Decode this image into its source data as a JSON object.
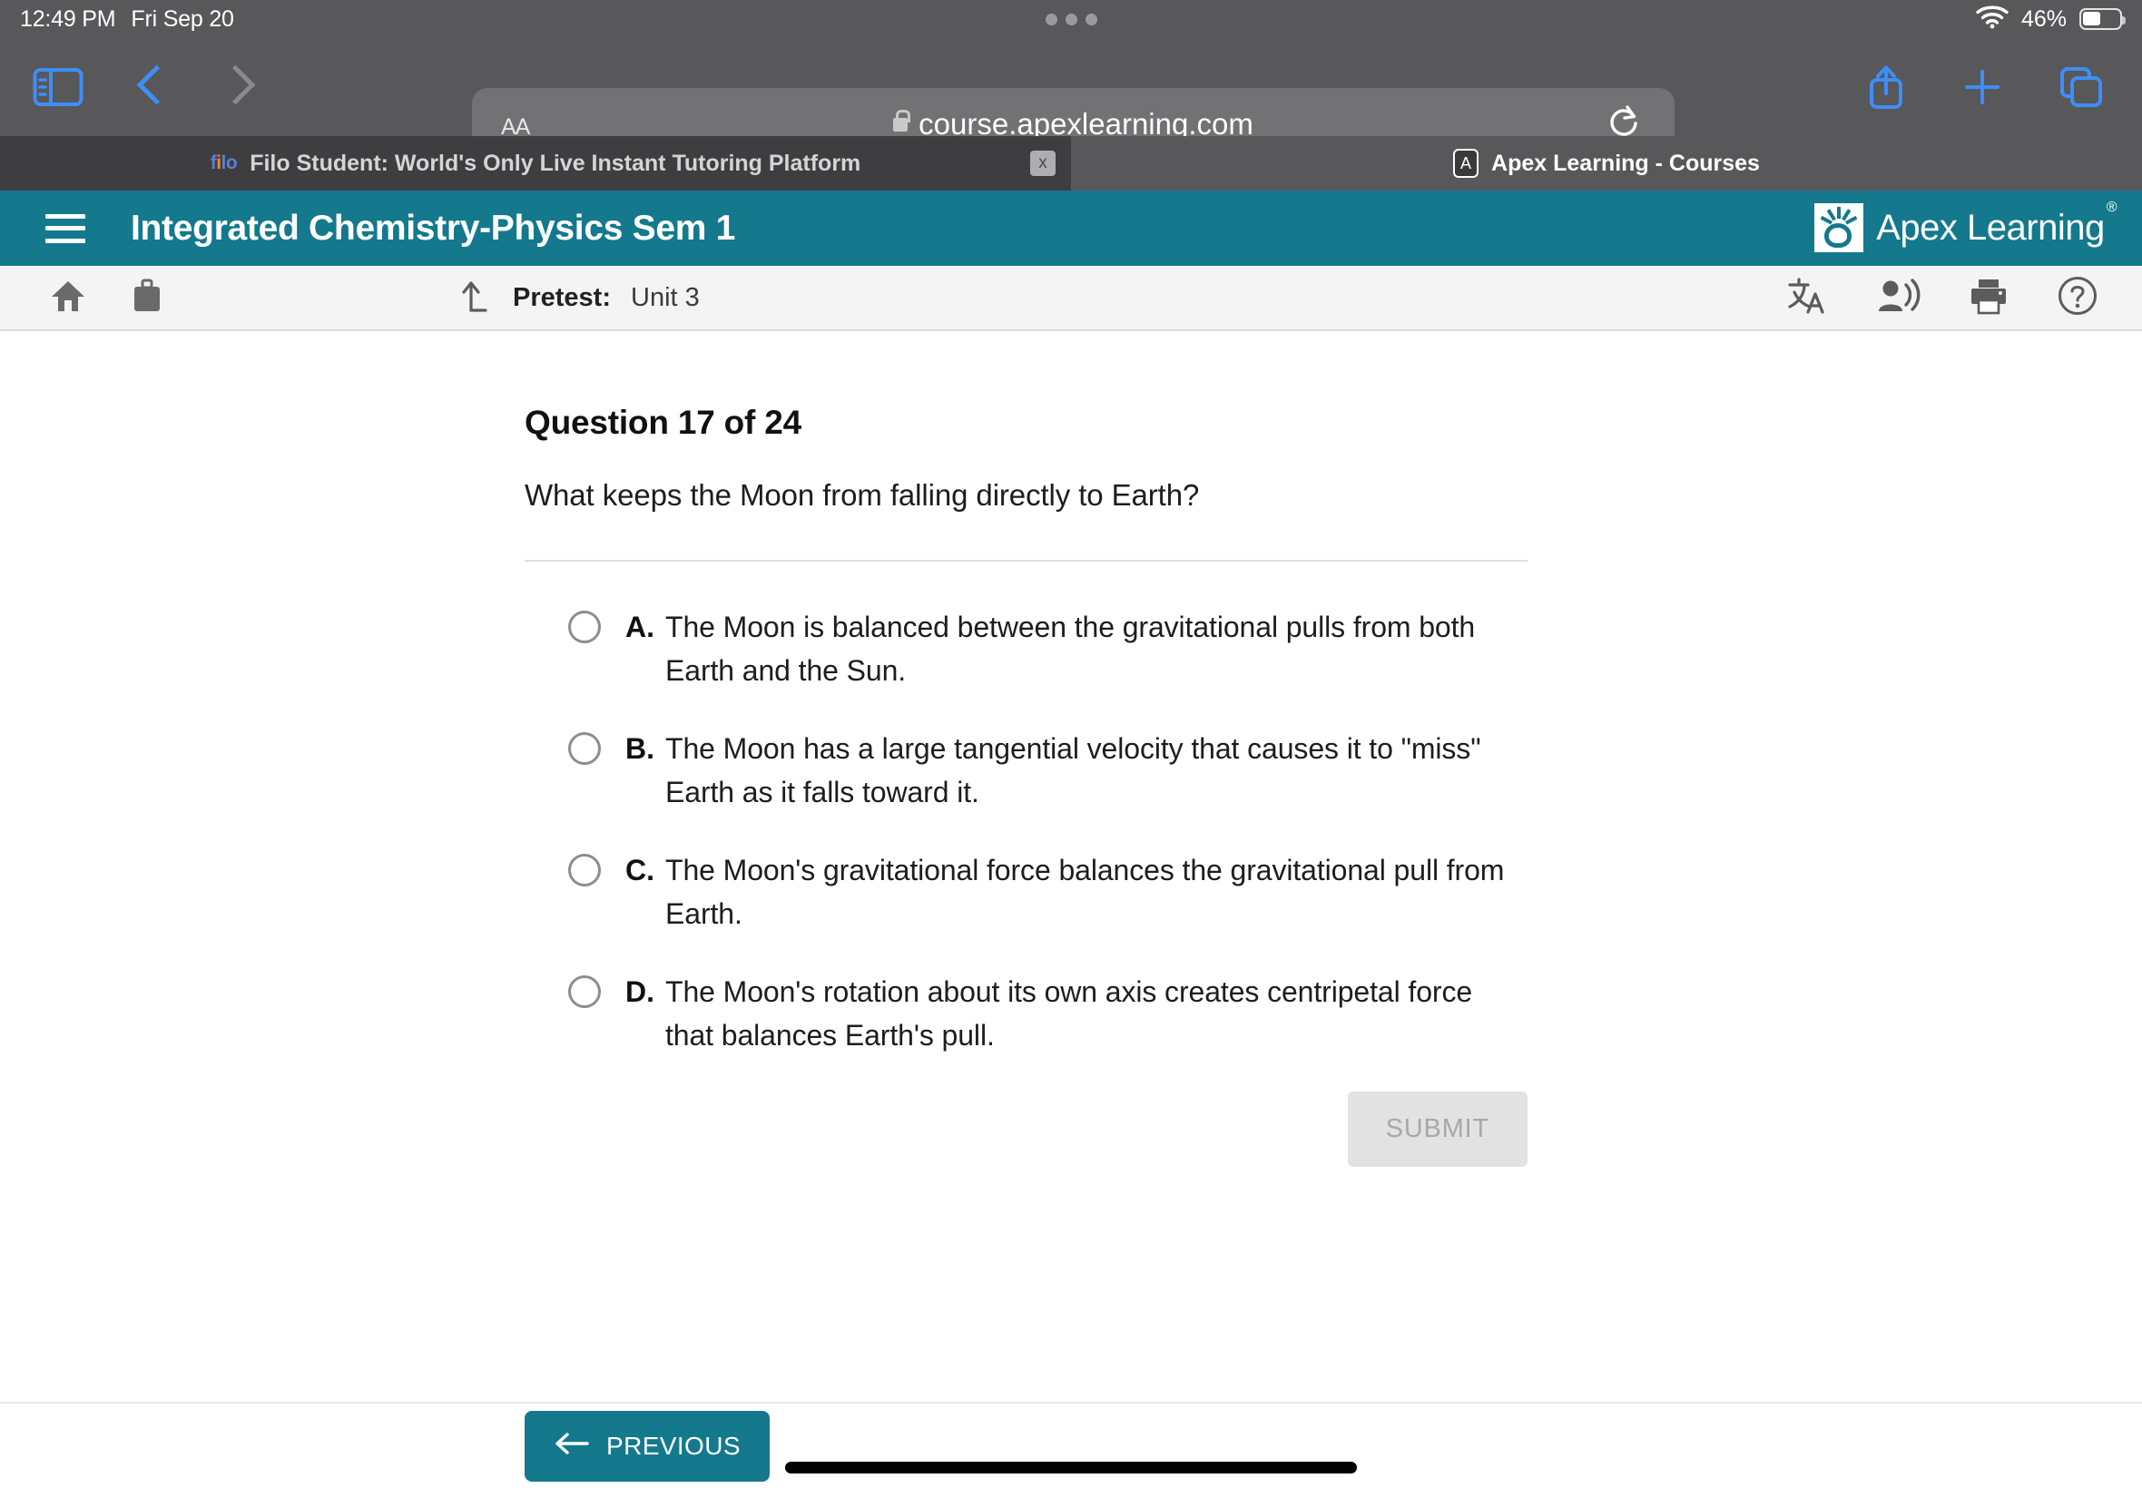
{
  "status_bar": {
    "time": "12:49 PM",
    "date": "Fri Sep 20",
    "battery_percent": "46%",
    "wifi_icon": "wifi-icon",
    "battery_icon": "battery-icon"
  },
  "browser": {
    "sidebar_icon": "sidebar-icon",
    "back_icon": "chevron-left-icon",
    "forward_icon": "chevron-right-icon",
    "text_size_label": "AA",
    "lock_icon": "lock-icon",
    "url": "course.apexlearning.com",
    "reload_icon": "reload-icon",
    "share_icon": "share-icon",
    "new_tab_icon": "plus-icon",
    "tabs_overview_icon": "tabs-icon",
    "tabs": [
      {
        "title": "Filo Student: World's Only Live Instant Tutoring Platform",
        "favicon": "filo-favicon",
        "favicon_text": "filo",
        "active": false,
        "close_label": "x"
      },
      {
        "title": "Apex Learning - Courses",
        "favicon": "apex-favicon",
        "favicon_text": "A",
        "active": true
      }
    ]
  },
  "app_header": {
    "menu_icon": "hamburger-menu-icon",
    "course_title": "Integrated Chemistry-Physics Sem 1",
    "logo_text": "Apex Learning",
    "logo_trademark": "®",
    "logo_icon": "apex-lightbulb-icon",
    "background_color": "#14798d"
  },
  "sub_toolbar": {
    "home_icon": "home-icon",
    "briefcase_icon": "briefcase-icon",
    "up_arrow_icon": "up-level-arrow-icon",
    "breadcrumb_label": "Pretest:",
    "breadcrumb_value": "Unit 3",
    "translate_icon": "translate-icon",
    "read_aloud_icon": "read-aloud-icon",
    "print_icon": "print-icon",
    "help_icon": "help-circle-icon"
  },
  "question": {
    "heading": "Question 17 of 24",
    "number": 17,
    "total": 24,
    "prompt": "What keeps the Moon from falling directly to Earth?",
    "choices": [
      {
        "letter": "A.",
        "text": "The Moon is balanced between the gravitational pulls from both Earth and the Sun.",
        "selected": false
      },
      {
        "letter": "B.",
        "text": "The Moon has a large tangential velocity that causes it to \"miss\" Earth as it falls toward it.",
        "selected": false
      },
      {
        "letter": "C.",
        "text": "The Moon's gravitational force balances the gravitational pull from Earth.",
        "selected": false
      },
      {
        "letter": "D.",
        "text": "The Moon's rotation about its own axis creates centripetal force that balances Earth's pull.",
        "selected": false
      }
    ],
    "submit_label": "SUBMIT",
    "submit_enabled": false
  },
  "bottom_nav": {
    "previous_label": "PREVIOUS",
    "previous_icon": "arrow-left-icon",
    "home_indicator": "home-indicator"
  }
}
